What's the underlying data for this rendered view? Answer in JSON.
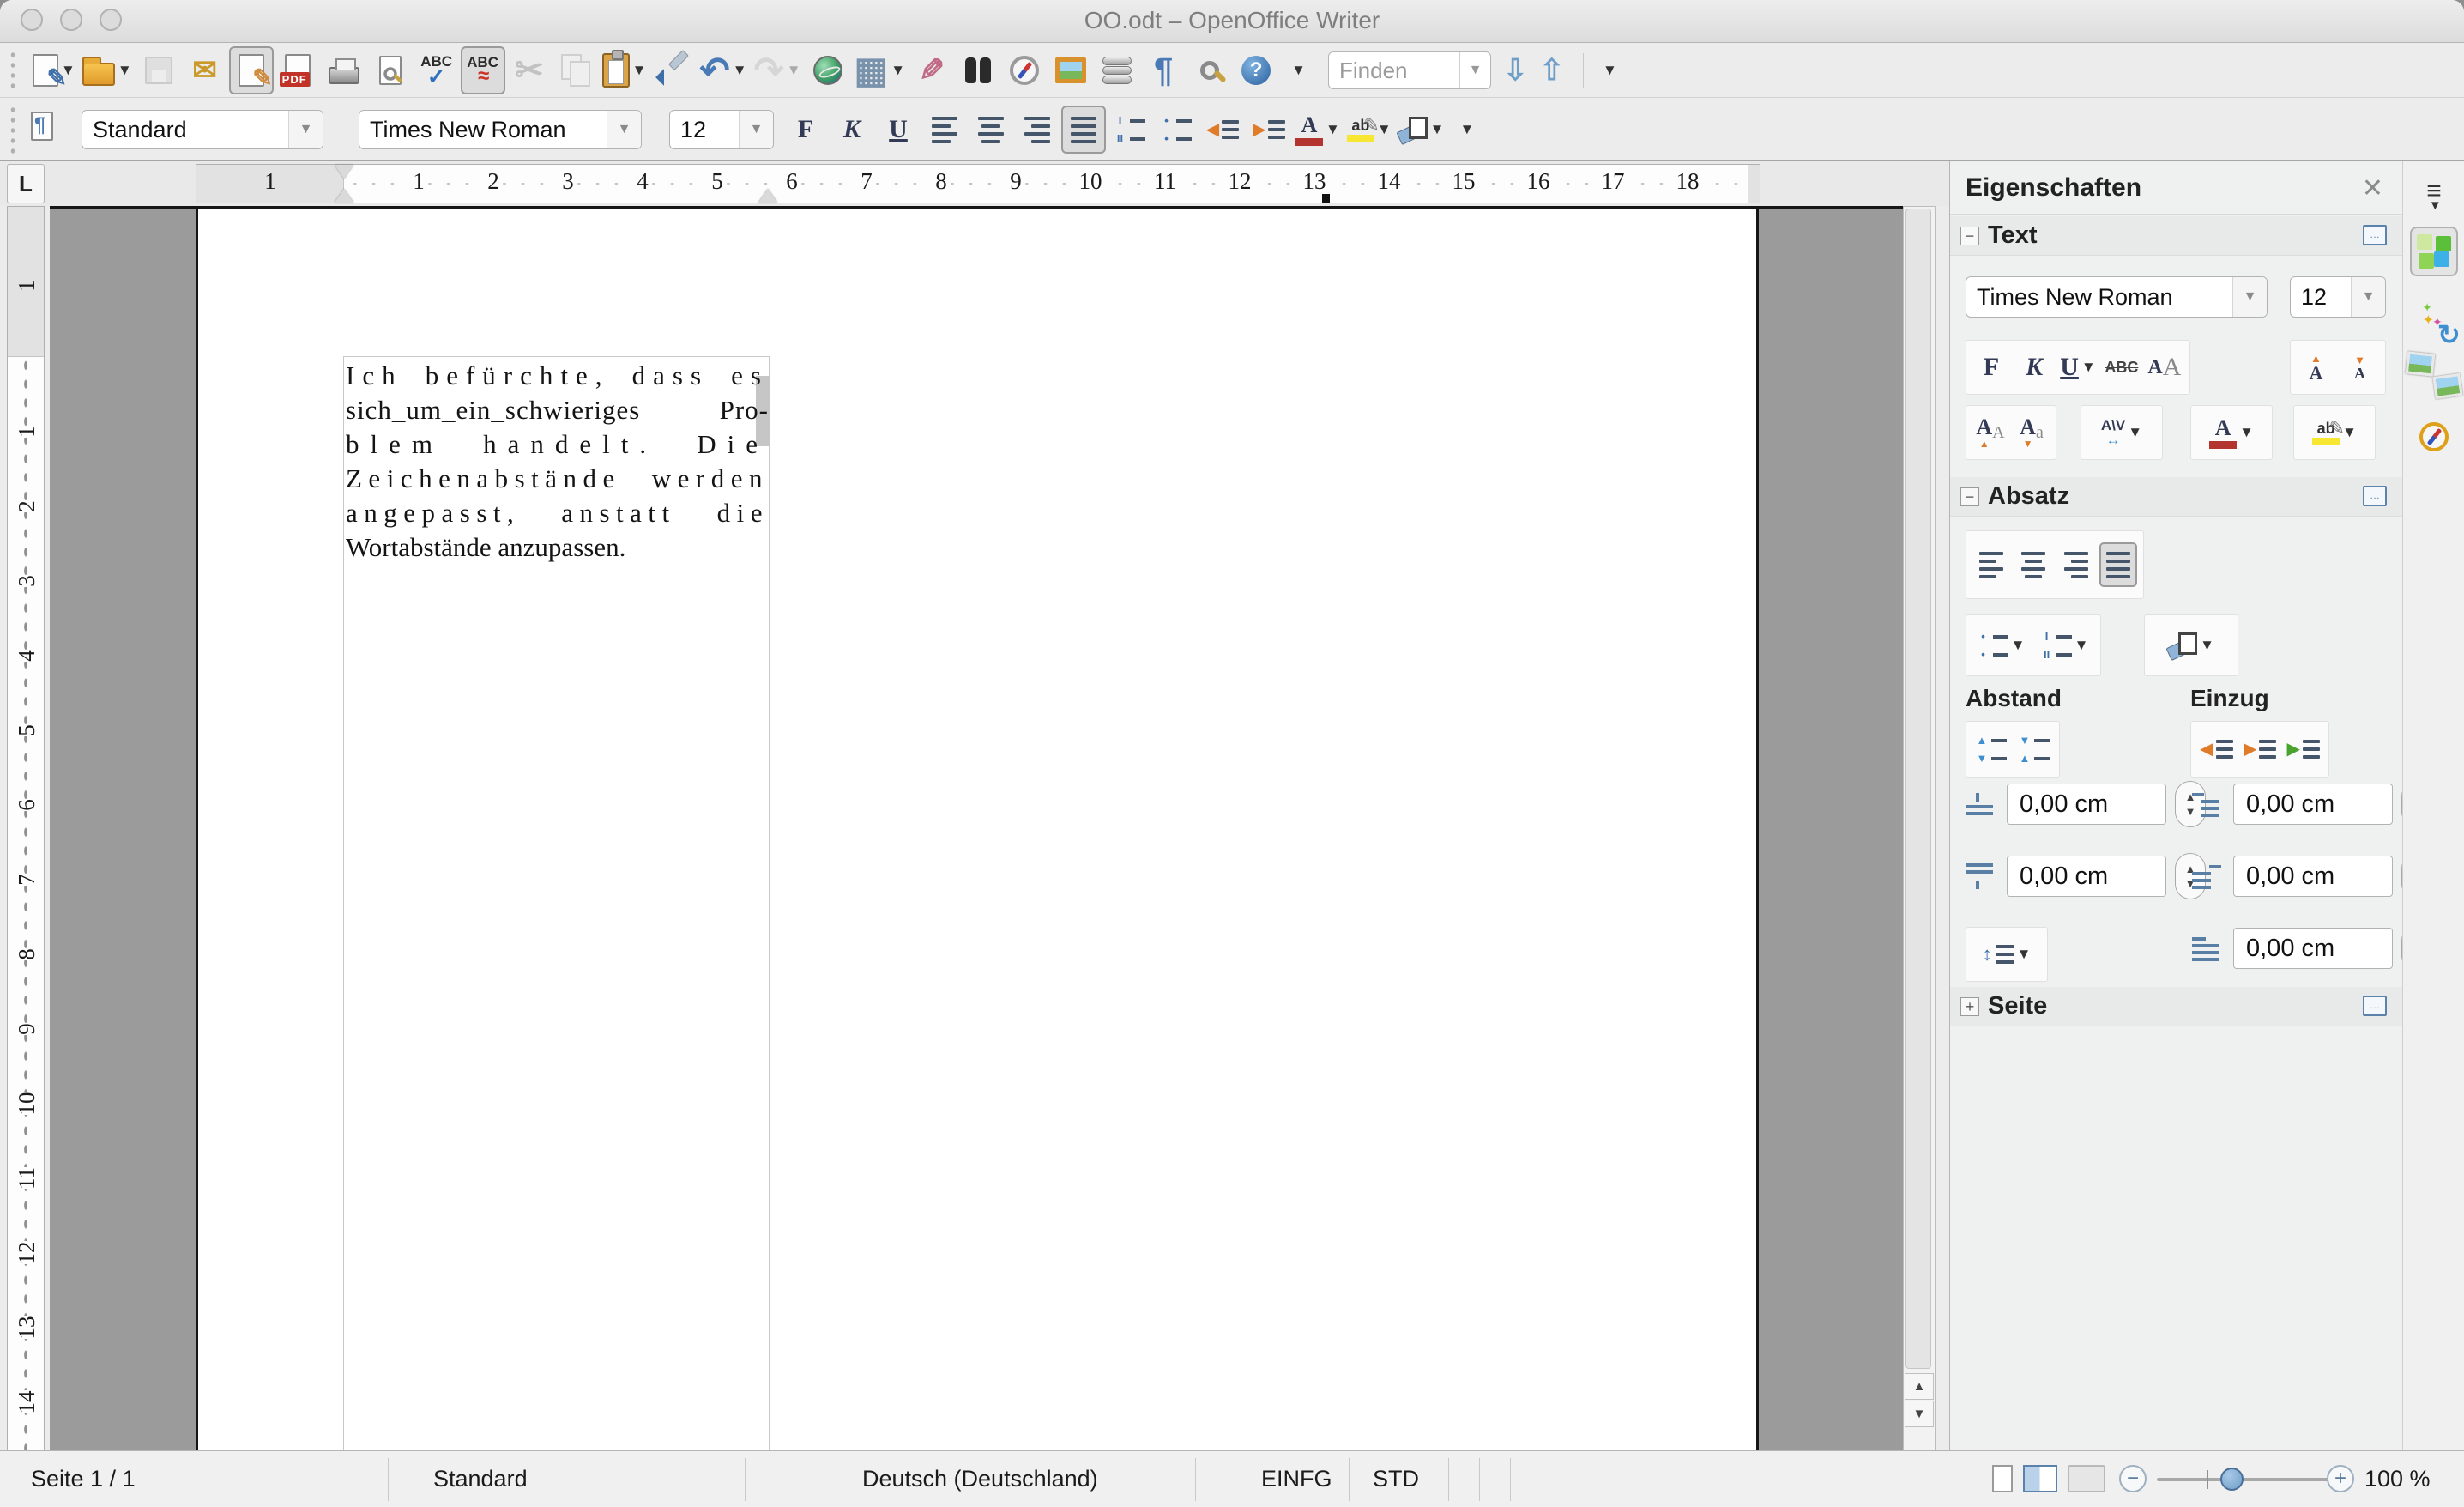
{
  "window": {
    "title": "OO.odt – OpenOffice Writer"
  },
  "toolbar_main": {
    "buttons": [
      {
        "name": "new-document",
        "icon": "new-document-icon",
        "kind": "pagenew",
        "dropdown": true
      },
      {
        "name": "open-file",
        "icon": "open-folder-icon",
        "kind": "folder",
        "dropdown": true
      },
      {
        "name": "save",
        "icon": "save-floppy-icon",
        "kind": "floppy",
        "disabled": true
      },
      {
        "name": "email-document",
        "icon": "email-envelope-icon",
        "kind": "mail"
      },
      {
        "name": "edit-mode",
        "icon": "edit-file-icon",
        "kind": "editdoc",
        "active": true
      },
      {
        "name": "export-pdf",
        "icon": "pdf-export-icon",
        "kind": "pdf",
        "label": "PDF"
      },
      {
        "name": "print",
        "icon": "printer-icon",
        "kind": "printer"
      },
      {
        "name": "page-preview",
        "icon": "page-preview-icon",
        "kind": "preview"
      },
      {
        "name": "spellcheck",
        "icon": "spellcheck-abc-icon",
        "kind": "abccheck",
        "label": "ABC"
      },
      {
        "name": "auto-spellcheck",
        "icon": "auto-spellcheck-abc-icon",
        "kind": "abcwave",
        "label": "ABC",
        "active": true
      },
      {
        "name": "cut",
        "icon": "scissors-icon",
        "kind": "cut",
        "disabled": true
      },
      {
        "name": "copy",
        "icon": "copy-pages-icon",
        "kind": "copy",
        "disabled": true
      },
      {
        "name": "paste",
        "icon": "clipboard-paste-icon",
        "kind": "paste",
        "dropdown": true
      },
      {
        "name": "format-paintbrush",
        "icon": "paintbrush-icon",
        "kind": "brush"
      },
      {
        "name": "undo",
        "icon": "undo-arrow-icon",
        "kind": "undo",
        "dropdown": true
      },
      {
        "name": "redo",
        "icon": "redo-arrow-icon",
        "kind": "redo",
        "disabled": true,
        "dropdown": true
      },
      {
        "name": "hyperlink",
        "icon": "globe-hyperlink-icon",
        "kind": "globe"
      },
      {
        "name": "insert-table",
        "icon": "table-grid-icon",
        "kind": "table",
        "dropdown": true
      },
      {
        "name": "draw-functions",
        "icon": "draw-pencil-icon",
        "kind": "draw"
      },
      {
        "name": "find-replace",
        "icon": "binoculars-icon",
        "kind": "binoc"
      },
      {
        "name": "navigator",
        "icon": "compass-icon",
        "kind": "compass"
      },
      {
        "name": "gallery",
        "icon": "picture-frame-icon",
        "kind": "gallery"
      },
      {
        "name": "data-sources",
        "icon": "database-icon",
        "kind": "db"
      },
      {
        "name": "formatting-marks",
        "icon": "pilcrow-icon",
        "kind": "pilcrow"
      },
      {
        "name": "zoom",
        "icon": "magnifier-icon",
        "kind": "mag"
      },
      {
        "name": "help",
        "icon": "help-question-icon",
        "kind": "help"
      }
    ]
  },
  "find": {
    "placeholder": "Finden"
  },
  "toolbar_format": {
    "style": "Standard",
    "font": "Times New Roman",
    "size": "12",
    "buttons": [
      {
        "name": "bold",
        "kind": "letter",
        "cls": "b",
        "label": "F"
      },
      {
        "name": "italic",
        "kind": "letter",
        "cls": "i",
        "label": "K"
      },
      {
        "name": "underline",
        "kind": "letter",
        "cls": "u",
        "label": "U"
      },
      {
        "name": "align-left",
        "kind": "align",
        "w": [
          30,
          22,
          30,
          22
        ]
      },
      {
        "name": "align-center",
        "kind": "aligncenter",
        "w": [
          30,
          22,
          30,
          22
        ]
      },
      {
        "name": "align-right",
        "kind": "alignright",
        "w": [
          30,
          22,
          30,
          22
        ]
      },
      {
        "name": "align-justify",
        "kind": "align",
        "w": [
          30,
          30,
          30,
          30
        ],
        "active": true
      },
      {
        "name": "numbered-list",
        "icon": "numbered-list-icon",
        "kind": "listnum"
      },
      {
        "name": "bullet-list",
        "icon": "bullet-list-icon",
        "kind": "listbul"
      },
      {
        "name": "decrease-indent",
        "icon": "decrease-indent-icon",
        "kind": "inddec"
      },
      {
        "name": "increase-indent",
        "icon": "increase-indent-icon",
        "kind": "indinc"
      },
      {
        "name": "font-color",
        "icon": "font-color-icon",
        "kind": "fontcolor",
        "color": "#b3342e",
        "dropdown": true
      },
      {
        "name": "highlighting",
        "icon": "highlight-icon",
        "kind": "highlight",
        "color": "#f7e733",
        "dropdown": true
      },
      {
        "name": "background-color",
        "icon": "paint-can-icon",
        "kind": "bgcolor",
        "dropdown": true
      }
    ]
  },
  "ruler": {
    "h_margin_label": "1",
    "h_numbers": [
      "1",
      "2",
      "3",
      "4",
      "5",
      "6",
      "7",
      "8",
      "9",
      "10",
      "11",
      "12",
      "13",
      "14",
      "15",
      "16",
      "17",
      "18"
    ],
    "v_margin_label": "1",
    "v_numbers": [
      "1",
      "2",
      "3",
      "4",
      "5",
      "6",
      "7",
      "8",
      "9",
      "10",
      "11",
      "12",
      "13",
      "14"
    ]
  },
  "document": {
    "paragraph_lines": [
      {
        "words": [
          "Ich",
          "befürchte,",
          "dass",
          "es"
        ],
        "letter_spacing": 9,
        "justify": true
      },
      {
        "words": [
          "sich_um_ein_schwieriges",
          "Pro-"
        ],
        "letter_spacing": 1,
        "justify": true
      },
      {
        "words": [
          "blem",
          "handelt.",
          "Die"
        ],
        "letter_spacing": 13,
        "justify": true
      },
      {
        "words": [
          "Zeichenabstände",
          "werden"
        ],
        "letter_spacing": 7.5,
        "justify": true
      },
      {
        "words": [
          "angepasst,",
          "anstatt",
          "die"
        ],
        "letter_spacing": 7.5,
        "justify": true
      },
      {
        "words": [
          "Wortabstände",
          "anzupassen."
        ],
        "letter_spacing": 0,
        "justify": false
      }
    ]
  },
  "sidebar": {
    "title": "Eigenschaften",
    "text_section": {
      "label": "Text",
      "font": "Times New Roman",
      "size": "12",
      "bold_label": "F",
      "italic_label": "K",
      "underline_label": "U",
      "strike_label": "ABC"
    },
    "absatz_section": {
      "label": "Absatz",
      "abstand_label": "Abstand",
      "einzug_label": "Einzug",
      "spacing_above": "0,00 cm",
      "spacing_below": "0,00 cm",
      "indent_before": "0,00 cm",
      "indent_after": "0,00 cm",
      "indent_first": "0,00 cm"
    },
    "seite_section": {
      "label": "Seite"
    },
    "tabs": [
      {
        "name": "properties",
        "icon": "cube-icon",
        "active": true
      },
      {
        "name": "styles-formatting",
        "icon": "styles-icon",
        "active": false
      },
      {
        "name": "gallery",
        "icon": "photos-icon",
        "active": false
      },
      {
        "name": "navigator",
        "icon": "compass-icon",
        "active": false
      }
    ]
  },
  "statusbar": {
    "page": "Seite 1 / 1",
    "style": "Standard",
    "language": "Deutsch (Deutschland)",
    "insert_mode": "EINFG",
    "selection_mode": "STD",
    "zoom_level": "100 %"
  }
}
